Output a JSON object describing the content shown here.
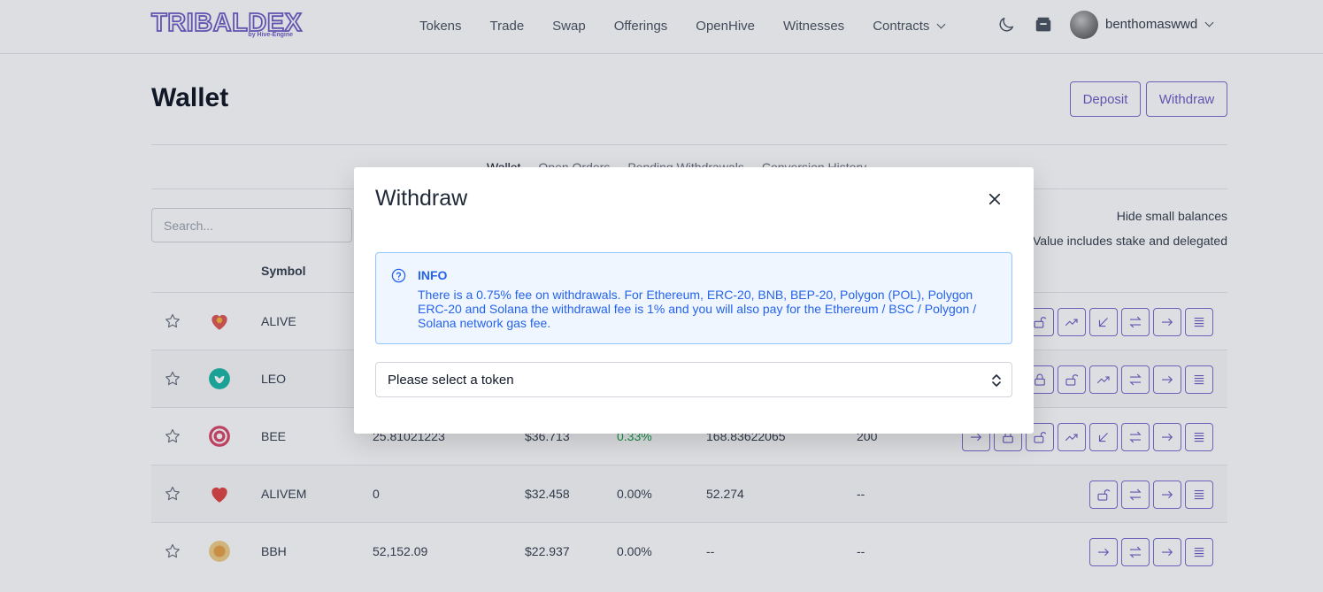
{
  "header": {
    "logo_text": "TRIBALDEX",
    "logo_sub": "by Hive-Engine",
    "nav": [
      "Tokens",
      "Trade",
      "Swap",
      "Offerings",
      "OpenHive",
      "Witnesses",
      "Contracts"
    ],
    "username": "benthomaswwd"
  },
  "page": {
    "title": "Wallet",
    "deposit_label": "Deposit",
    "withdraw_label": "Withdraw",
    "tabs": [
      "Wallet",
      "Open Orders",
      "Pending Withdrawals",
      "Conversion History"
    ],
    "search_placeholder": "Search...",
    "hide_small": "Hide small balances",
    "value_note": "Value includes stake and delegated",
    "col_symbol": "Symbol"
  },
  "rows": [
    {
      "symbol": "ALIVE",
      "balance": "",
      "price": "",
      "change": "",
      "value": "",
      "staked": ""
    },
    {
      "symbol": "LEO",
      "balance": "",
      "price": "",
      "change": "",
      "value": "",
      "staked": ""
    },
    {
      "symbol": "BEE",
      "balance": "25.81021223",
      "price": "$36.713",
      "change": "0.33%",
      "value": "168.83622065",
      "staked": "200"
    },
    {
      "symbol": "ALIVEM",
      "balance": "0",
      "price": "$32.458",
      "change": "0.00%",
      "value": "52.274",
      "staked": "--"
    },
    {
      "symbol": "BBH",
      "balance": "52,152.09",
      "price": "$22.937",
      "change": "0.00%",
      "value": "--",
      "staked": "--"
    }
  ],
  "modal": {
    "title": "Withdraw",
    "info_title": "INFO",
    "info_text": "There is a 0.75% fee on withdrawals. For Ethereum, ERC-20, BNB, BEP-20, Polygon (POL), Polygon ERC-20 and Solana the withdrawal fee is 1% and you will also pay for the Ethereum / BSC / Polygon / Solana network gas fee.",
    "select_value": "Please select a token"
  },
  "colors": {
    "accent": "#6f5fc7",
    "info": "#2563eb",
    "info_bg": "#eff6ff"
  }
}
